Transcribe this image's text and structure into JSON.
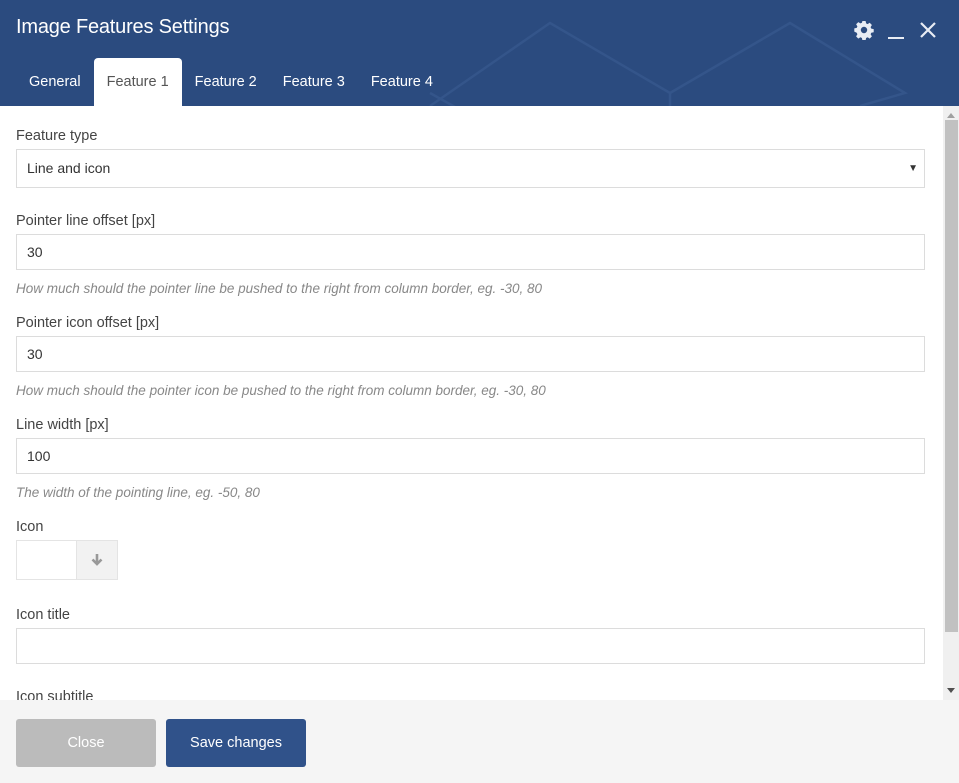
{
  "window": {
    "title": "Image Features Settings",
    "icons": [
      "gear-icon",
      "minimize-icon",
      "close-icon"
    ]
  },
  "colors": {
    "header_bg": "#2b4b7f",
    "save_button": "#30528a",
    "close_button": "#bbbbbb",
    "footer_bg": "#f5f5f5"
  },
  "tabs": [
    {
      "label": "General",
      "active": false
    },
    {
      "label": "Feature 1",
      "active": true
    },
    {
      "label": "Feature 2",
      "active": false
    },
    {
      "label": "Feature 3",
      "active": false
    },
    {
      "label": "Feature 4",
      "active": false
    }
  ],
  "form": {
    "feature_type": {
      "label": "Feature type",
      "value": "Line and icon"
    },
    "pointer_line_offset": {
      "label": "Pointer line offset [px]",
      "value": "30",
      "hint": "How much should the pointer line be pushed to the right from column border, eg. -30, 80"
    },
    "pointer_icon_offset": {
      "label": "Pointer icon offset [px]",
      "value": "30",
      "hint": "How much should the pointer icon be pushed to the right from column border, eg. -30, 80"
    },
    "line_width": {
      "label": "Line width [px]",
      "value": "100",
      "hint": "The width of the pointing line, eg. -50, 80"
    },
    "icon": {
      "label": "Icon"
    },
    "icon_title": {
      "label": "Icon title",
      "value": ""
    },
    "icon_subtitle": {
      "label": "Icon subtitle"
    }
  },
  "footer": {
    "close_label": "Close",
    "save_label": "Save changes"
  }
}
